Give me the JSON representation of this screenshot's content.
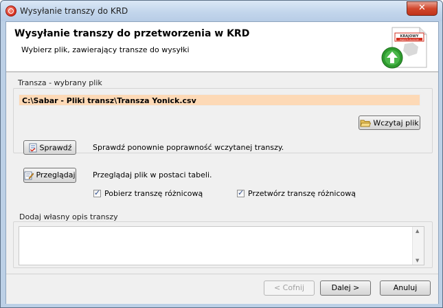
{
  "window": {
    "title": "Wysyłanie transzy do KRD",
    "close_symbol": "✕"
  },
  "header": {
    "title": "Wysyłanie transzy do przetworzenia w KRD",
    "subtitle": "Wybierz plik, zawierający transze do wysyłki",
    "logo": {
      "icon": "krd-upload-logo-icon",
      "text_line1": "KRAJOWY",
      "text_line2": "REJESTR DŁUGÓW"
    }
  },
  "file_section": {
    "label": "Transza - wybrany plik",
    "path": "C:\\Sabar - Pliki transz\\Transza Yonick.csv",
    "load_button": "Wczytaj plik",
    "load_icon": "folder-open-icon"
  },
  "actions": {
    "check_button": "Sprawdź",
    "check_icon": "checklist-icon",
    "check_desc": "Sprawdź ponownie poprawność wczytanej transzy.",
    "browse_button": "Przeglądaj",
    "browse_icon": "document-edit-icon",
    "browse_desc": "Przeglądaj plik w postaci tabeli."
  },
  "options": {
    "fetch_diff": {
      "label": "Pobierz transzę różnicową",
      "checked": true
    },
    "process_diff": {
      "label": "Przetwórz transzę różnicową",
      "checked": true
    }
  },
  "description": {
    "label": "Dodaj własny opis transzy",
    "value": ""
  },
  "footer": {
    "back_button": "< Cofnij",
    "next_button": "Dalej >",
    "cancel_button": "Anuluj"
  },
  "colors": {
    "path_background": "#fdd9b6",
    "logo_red": "#d22c1c",
    "logo_green": "#2e9a2e"
  }
}
